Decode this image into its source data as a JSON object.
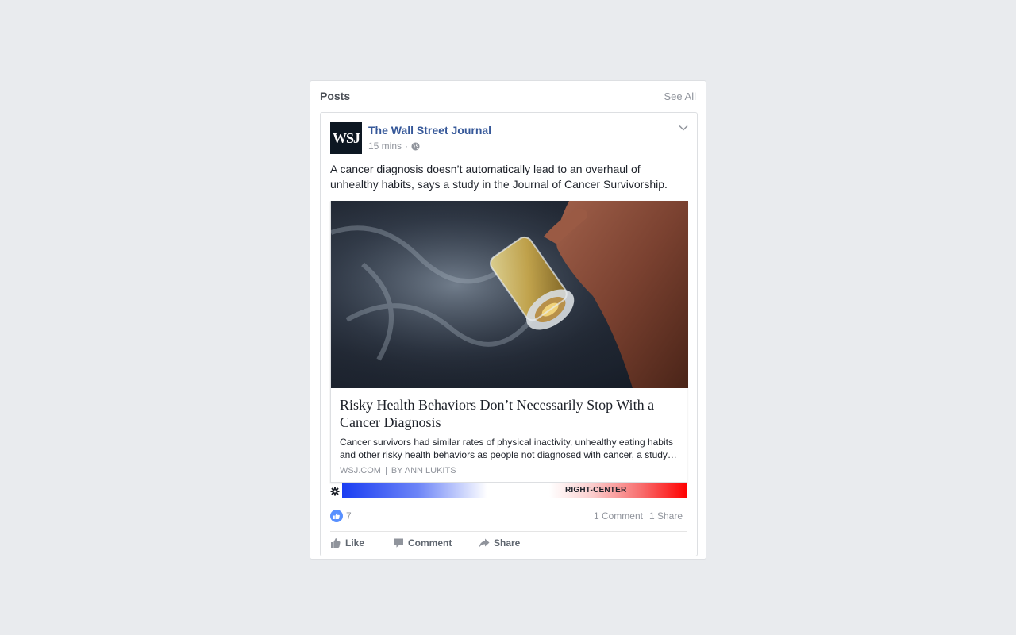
{
  "panel": {
    "title": "Posts",
    "see_all": "See All"
  },
  "post": {
    "avatar_text": "WSJ",
    "page_name": "The Wall Street Journal",
    "timestamp": "15 mins",
    "meta_separator": "·",
    "visibility_icon": "globe-icon",
    "text": "A cancer diagnosis doesn’t automatically lead to an overhaul of unhealthy habits, says a study in the Journal of Cancer Survivorship.",
    "link": {
      "title": "Risky Health Behaviors Don’t Necessarily Stop With a Cancer Diagnosis",
      "description": "Cancer survivors had similar rates of physical inactivity, unhealthy eating habits and other risky health behaviors as people not diagnosed with cancer, a study…",
      "source": "WSJ.COM",
      "separator": "|",
      "author": "BY ANN LUKITS"
    },
    "bias": {
      "label": "RIGHT-CENTER",
      "colors": {
        "left": "#1a3df2",
        "center": "#ffffff",
        "right": "#ff0000"
      }
    },
    "reactions": {
      "like_count": "7",
      "comments": "1 Comment",
      "shares": "1 Share"
    },
    "actions": {
      "like": "Like",
      "comment": "Comment",
      "share": "Share"
    }
  },
  "colors": {
    "background": "#e9ebee",
    "link_blue": "#365899",
    "muted": "#90949c",
    "like_blue": "#5890ff"
  }
}
